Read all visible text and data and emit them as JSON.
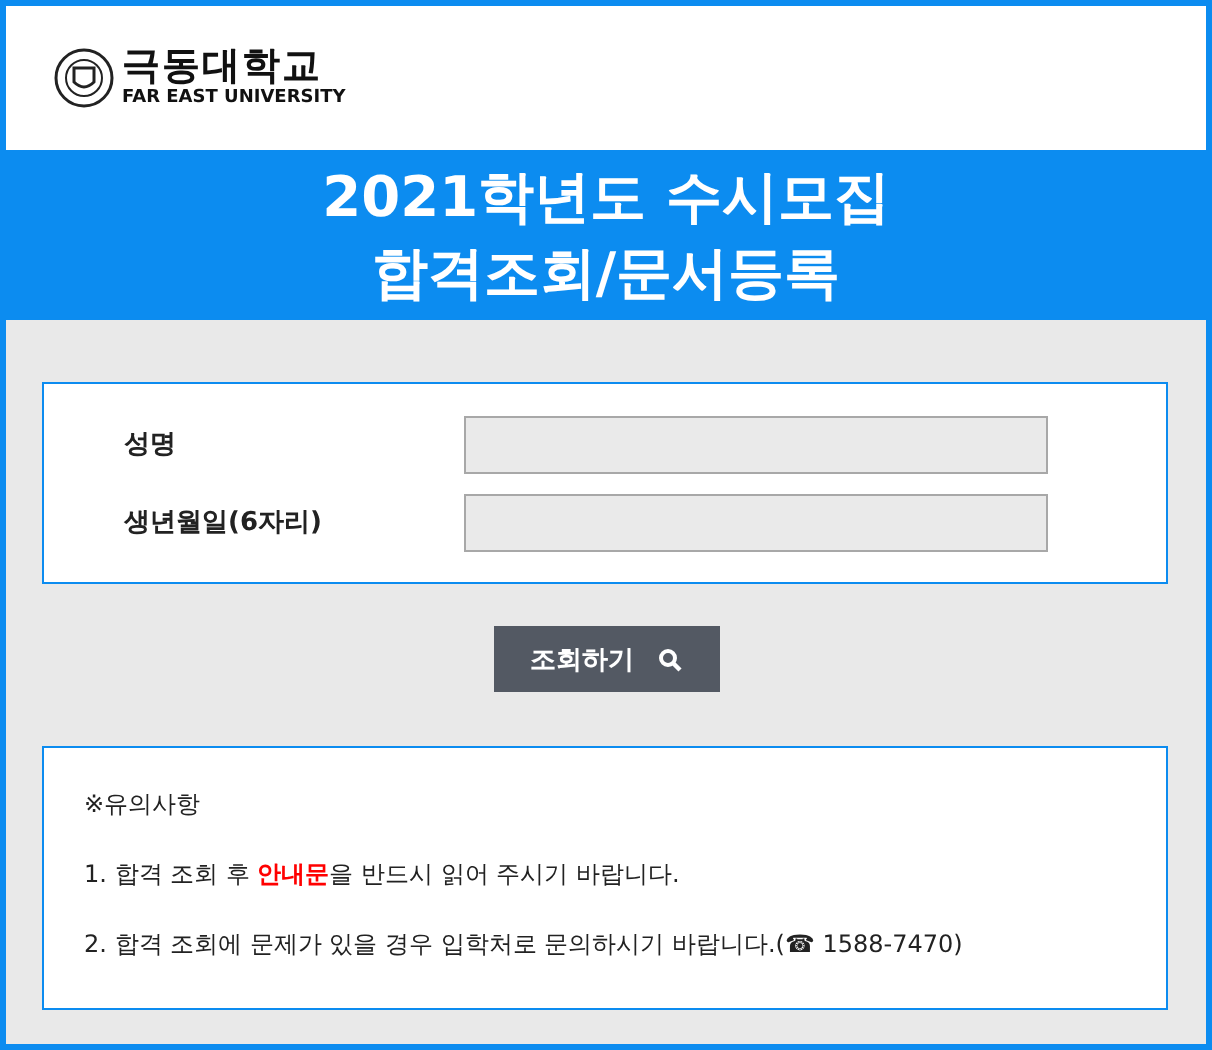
{
  "header": {
    "logo_korean": "극동대학교",
    "logo_english": "FAR EAST UNIVERSITY"
  },
  "banner": {
    "lines": [
      "2021학년도 수시모집",
      "합격조회/문서등록"
    ]
  },
  "form": {
    "fields": [
      {
        "label": "성명"
      },
      {
        "label": "생년월일(6자리)"
      }
    ]
  },
  "search_button": {
    "label": "조회하기"
  },
  "notice": {
    "title": "※유의사항",
    "items": [
      "1. 합격 조회 후 **안내문**을 반드시 읽어 주시기 바랍니다.",
      "2. 합격 조회에 문제가 있을 경우 입학처로 문의하시기 바랍니다.(☎ 1588-7470)"
    ]
  }
}
